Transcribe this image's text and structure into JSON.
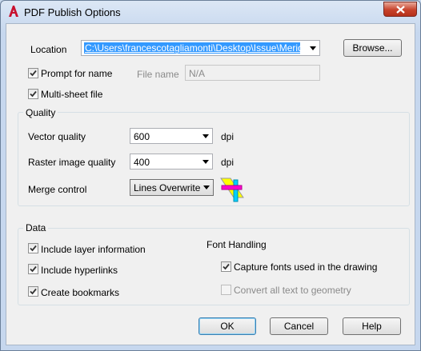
{
  "window": {
    "title": "PDF Publish Options"
  },
  "location": {
    "label": "Location",
    "value": "C:\\Users\\francescotagliamonti\\Desktop\\Issue\\Meriden\\",
    "browse_label": "Browse..."
  },
  "prompt_for_name": {
    "label": "Prompt for name",
    "checked": true
  },
  "file_name": {
    "label": "File name",
    "value": "N/A"
  },
  "multi_sheet": {
    "label": "Multi-sheet file",
    "checked": true
  },
  "quality": {
    "header": "Quality",
    "vector_label": "Vector quality",
    "vector_value": "600",
    "vector_unit": "dpi",
    "raster_label": "Raster image quality",
    "raster_value": "400",
    "raster_unit": "dpi",
    "merge_label": "Merge control",
    "merge_value": "Lines Overwrite"
  },
  "data_section": {
    "header": "Data",
    "include_layer": {
      "label": "Include layer information",
      "checked": true
    },
    "include_hyperlinks": {
      "label": "Include hyperlinks",
      "checked": true
    },
    "create_bookmarks": {
      "label": "Create bookmarks",
      "checked": true
    }
  },
  "font_handling": {
    "header": "Font Handling",
    "capture_fonts": {
      "label": "Capture fonts used in the drawing",
      "checked": true
    },
    "convert_text": {
      "label": "Convert all text to geometry",
      "checked": false
    }
  },
  "buttons": {
    "ok": "OK",
    "cancel": "Cancel",
    "help": "Help"
  },
  "colors": {
    "selection": "#3399ff",
    "title_bg": "#c6d7ee",
    "close": "#c7422b"
  }
}
